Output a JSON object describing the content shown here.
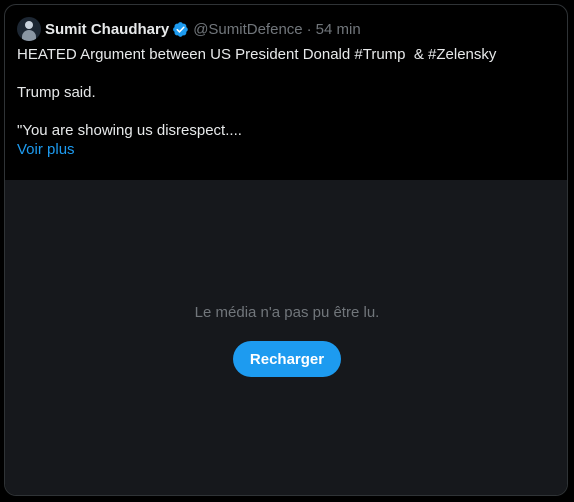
{
  "tweet": {
    "author_name": "Sumit Chaudhary",
    "verified_icon": "verified-badge-icon",
    "handle": "@SumitDefence",
    "separator": "·",
    "time": "54 min",
    "lines": [
      "HEATED Argument between US President Donald #Trump  & #Zelensky",
      "Trump said.",
      "\"You are showing us disrespect...."
    ],
    "show_more": "Voir plus"
  },
  "media": {
    "error_message": "Le média n'a pas pu être lu.",
    "reload_label": "Recharger"
  },
  "colors": {
    "background": "#000000",
    "media_background": "#16181c",
    "accent": "#1d9bf0",
    "muted_text": "#71767b",
    "primary_text": "#e7e9ea"
  }
}
